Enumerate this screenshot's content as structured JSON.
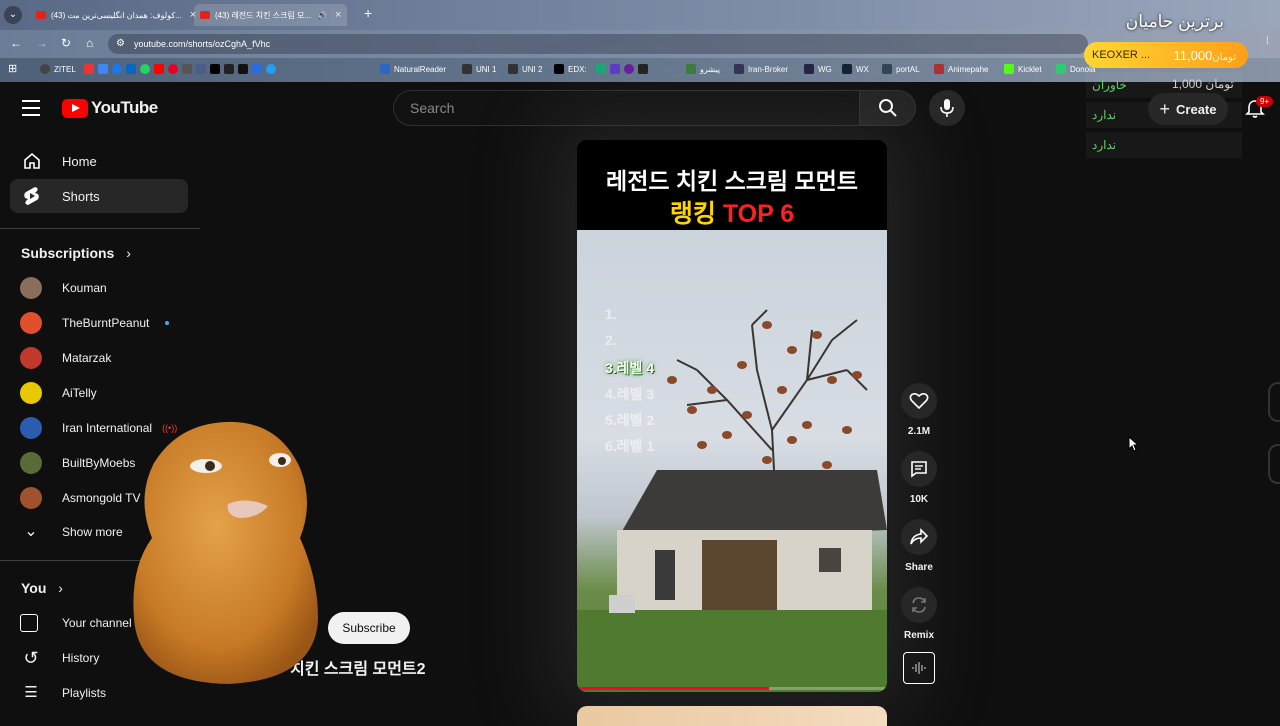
{
  "browser": {
    "tabs": [
      {
        "label": "(43) کولوف: همدان انگلیسی‌ترین مت..."
      },
      {
        "label": "(43) 레전드 치킨 스크림 모..."
      }
    ],
    "url": "youtube.com/shorts/ozCghA_fVhc",
    "bookmarks": [
      "ZITEL",
      "NaturalReader",
      "UNI 1",
      "UNI 2",
      "EDX:",
      "پیشرو",
      "Iran-Broker",
      "WG",
      "WX",
      "portAL",
      "Animepahe",
      "Kicklet",
      "Donola"
    ]
  },
  "donation_overlay": {
    "title": "برترین حامیان",
    "top_name": "KEOXER ...",
    "top_currency": "تومان",
    "top_amount": "11,000",
    "second_amount": "1,000 تومان",
    "rows": [
      "خاوران",
      "ندارد",
      "ندارد"
    ]
  },
  "header": {
    "logo_text": "YouTube",
    "search_placeholder": "Search",
    "create_label": "Create",
    "notification_badge": "9+"
  },
  "sidebar": {
    "main_items": [
      {
        "label": "Home"
      },
      {
        "label": "Shorts"
      }
    ],
    "subscriptions_heading": "Subscriptions",
    "subscriptions": [
      {
        "name": "Kouman",
        "color": "#8a6d5a"
      },
      {
        "name": "TheBurntPeanut",
        "color": "#e0502a"
      },
      {
        "name": "Matarzak",
        "color": "#c0392b"
      },
      {
        "name": "AiTelly",
        "color": "#e8c800"
      },
      {
        "name": "Iran International",
        "color": "#2a5db0"
      },
      {
        "name": "BuiltByMoebs",
        "color": "#5a6b3a"
      },
      {
        "name": "Asmongold TV",
        "color": "#a0522d"
      }
    ],
    "show_more": "Show more",
    "you_heading": "You",
    "you_items": [
      {
        "label": "Your channel"
      },
      {
        "label": "History"
      },
      {
        "label": "Playlists"
      }
    ]
  },
  "short": {
    "title_line1": "레전드 치킨 스크림 모먼트",
    "title_line2_yellow": "랭킹",
    "title_line2_red": "TOP 6",
    "ranking": [
      "1.",
      "2.",
      "3.레벨 4",
      "4.레벨 3",
      "5.레벨 2",
      "6.레벨 1"
    ],
    "current_rank_index": 2,
    "progress": 0.62,
    "caption": "치킨 스크림 모먼트2",
    "subscribe_label": "Subscribe"
  },
  "actions": {
    "like_count": "2.1M",
    "comment_count": "10K",
    "share_label": "Share",
    "remix_label": "Remix"
  }
}
